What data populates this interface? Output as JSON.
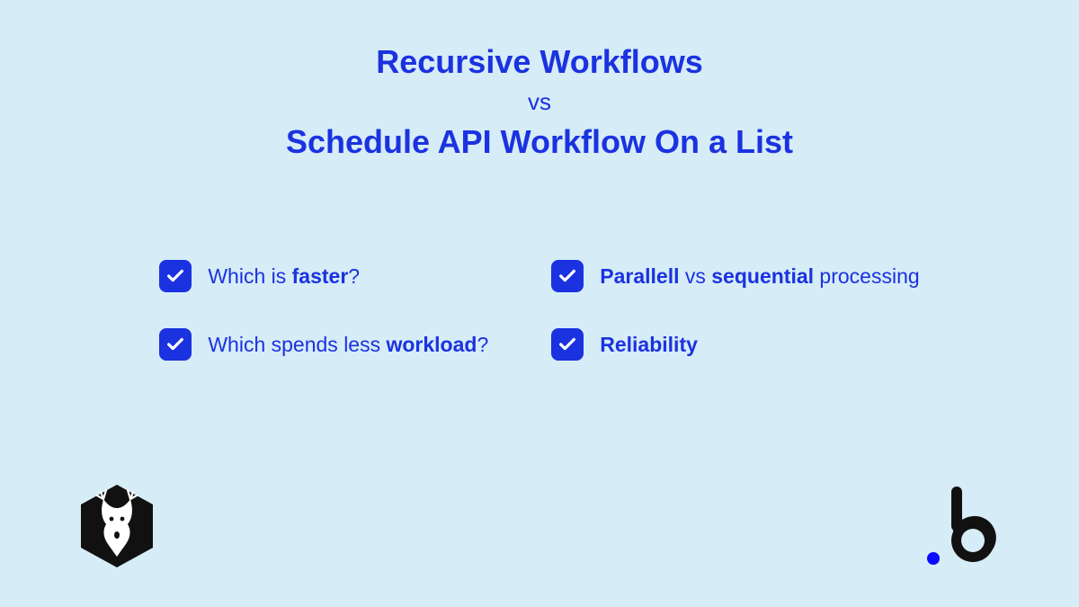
{
  "heading": {
    "line1": "Recursive Workflows",
    "vs": "vs",
    "line2": "Schedule API Workflow On a List"
  },
  "left_col": {
    "item1": {
      "prefix": "Which is ",
      "bold": "faster",
      "suffix": "?"
    },
    "item2": {
      "prefix": "Which spends less ",
      "bold": "workload",
      "suffix": "?"
    }
  },
  "right_col": {
    "item1": {
      "bold1": "Parallell",
      "mid": " vs ",
      "bold2": "sequential",
      "suffix": " processing"
    },
    "item2": {
      "bold": "Reliability"
    }
  },
  "colors": {
    "accent": "#1b32e0",
    "bg": "#d6ecf7"
  }
}
